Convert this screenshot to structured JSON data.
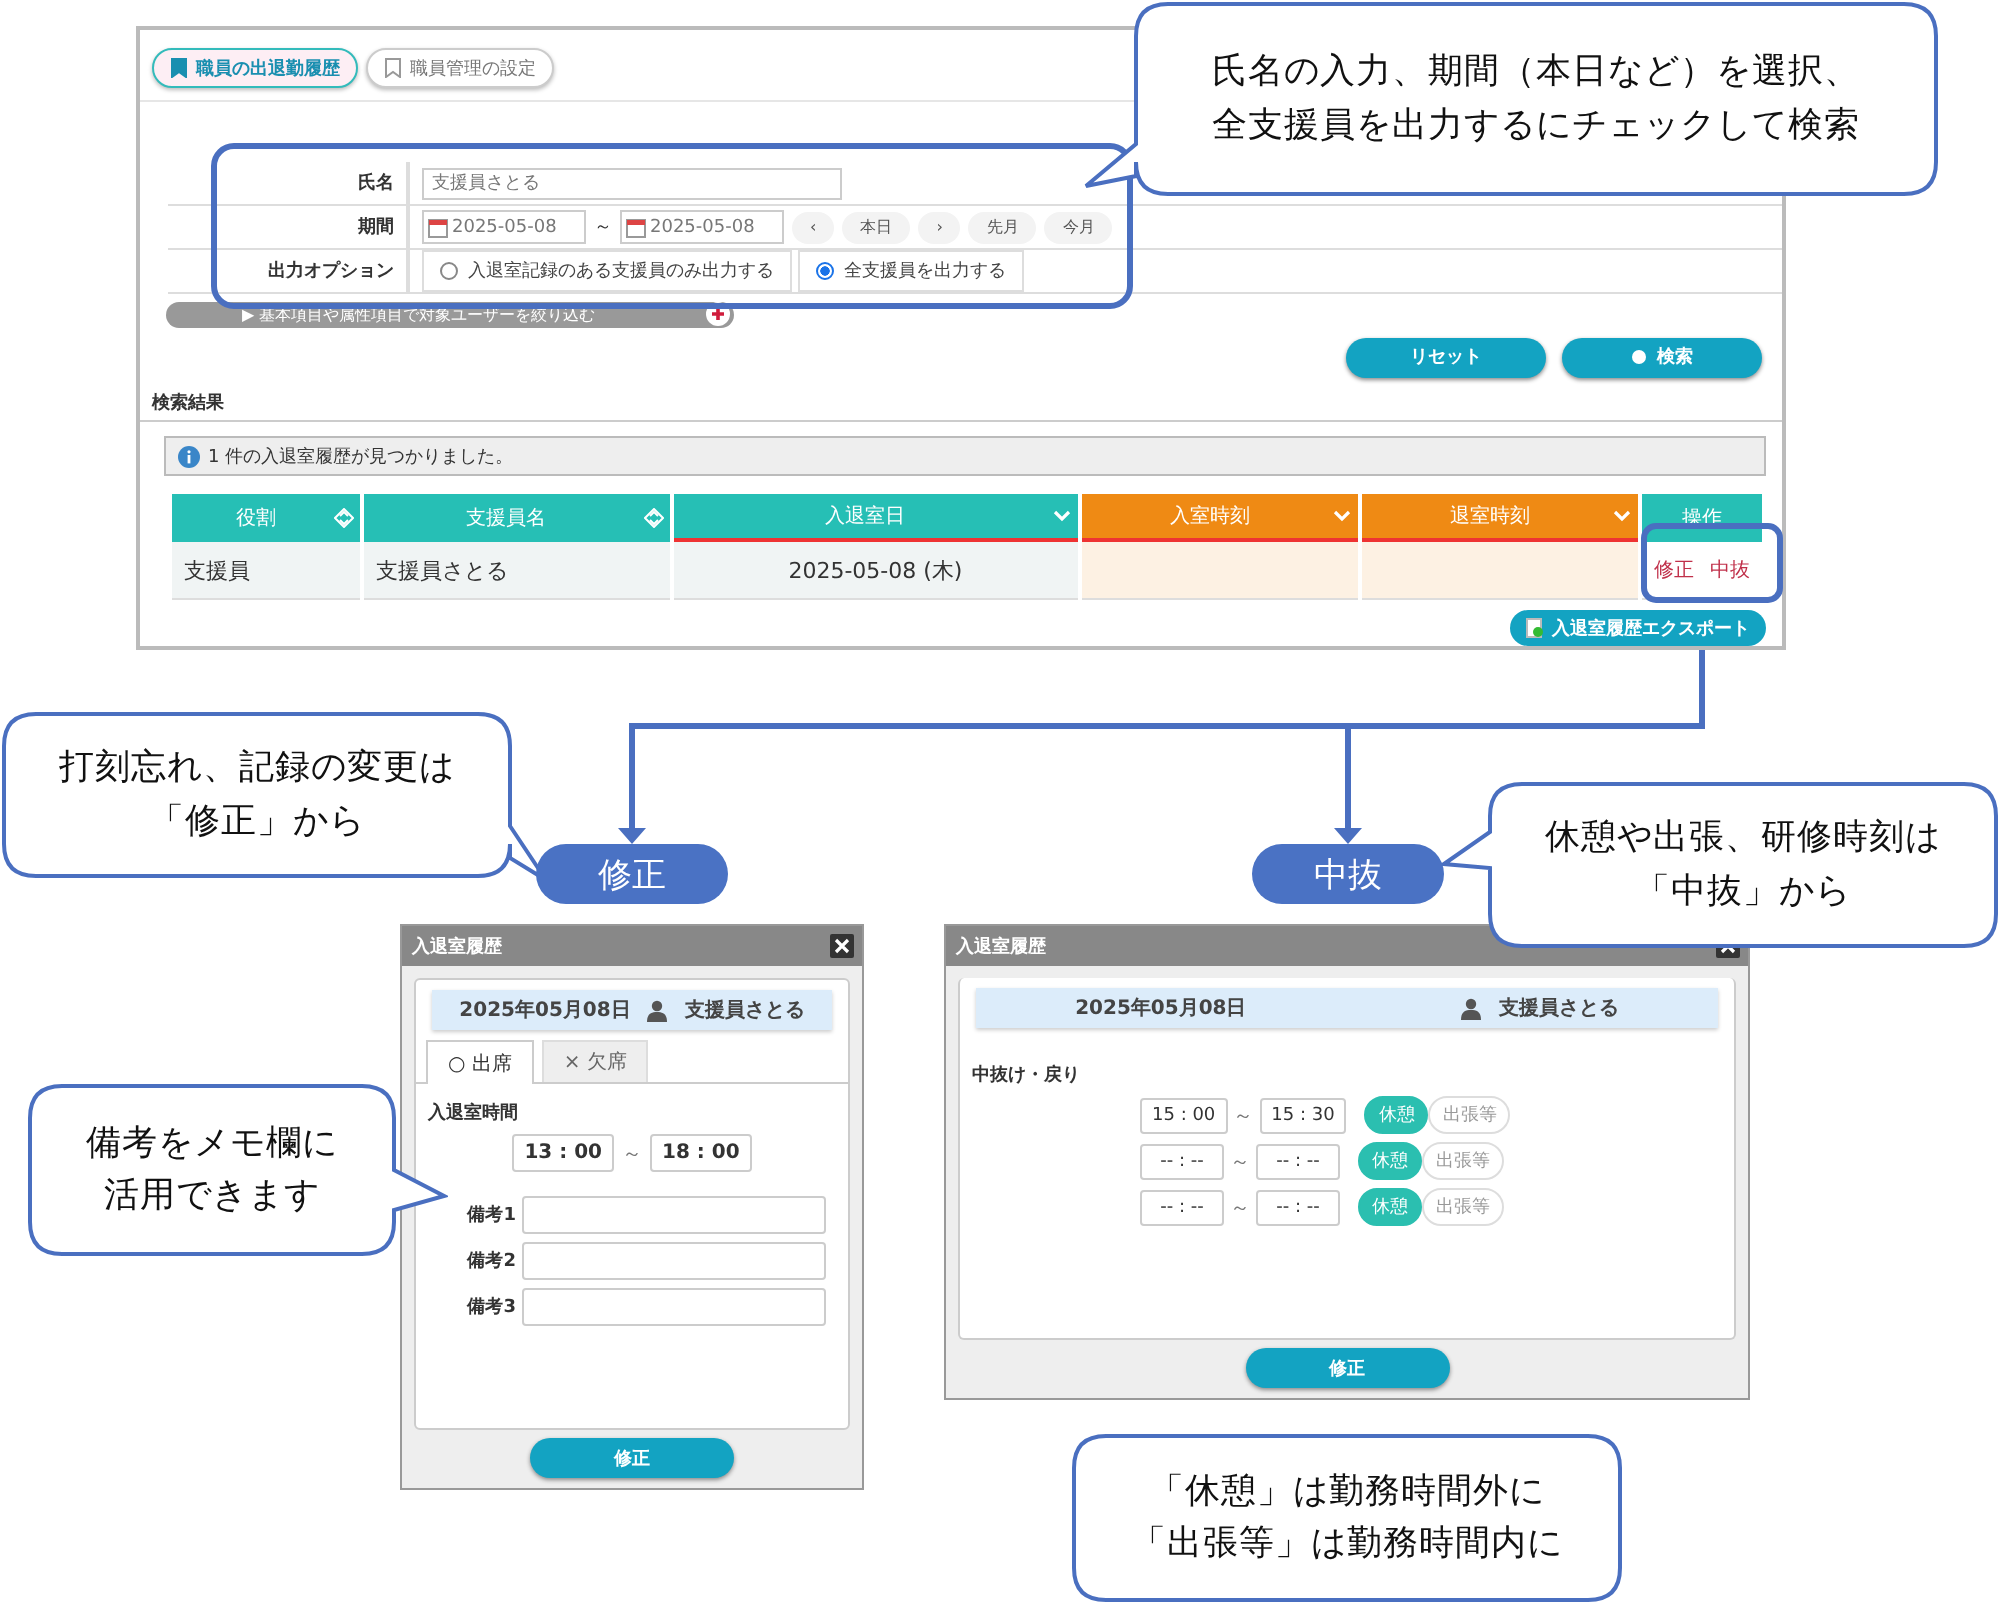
{
  "main_window": {
    "tabs": [
      {
        "label": "職員の出退勤履歴",
        "selected": true
      },
      {
        "label": "職員管理の設定",
        "selected": false
      }
    ],
    "search_form": {
      "rows": [
        {
          "label": "氏名",
          "kind": "text",
          "value": "支援員さとる"
        },
        {
          "label": "期間",
          "kind": "period",
          "from": "2025-05-08",
          "separator": "～",
          "to": "2025-05-08",
          "nav": [
            "‹",
            "本日",
            "›",
            "先月",
            "今月"
          ]
        },
        {
          "label": "出力オプション",
          "kind": "radio",
          "options": [
            {
              "label": "入退室記録のある支援員のみ出力する",
              "selected": false
            },
            {
              "label": "全支援員を出力する",
              "selected": true
            }
          ]
        }
      ]
    },
    "filter_bar": "▶ 基本項目や属性項目で対象ユーザーを絞り込む",
    "buttons": [
      {
        "label": "リセット",
        "kind": "plain"
      },
      {
        "label": "検索",
        "kind": "search"
      }
    ],
    "results_title": "検索結果",
    "message": "1 件の入退室履歴が見つかりました。",
    "table": {
      "columns": [
        {
          "label": "役割",
          "color": "#26bfb5",
          "kind": "both",
          "sorted": false
        },
        {
          "label": "支援員名",
          "color": "#26bfb5",
          "kind": "both",
          "sorted": false
        },
        {
          "label": "入退室日",
          "color": "#26bfb5",
          "kind": "down",
          "sorted": true
        },
        {
          "label": "入室時刻",
          "color": "#ef8a14",
          "kind": "down",
          "sorted": true
        },
        {
          "label": "退室時刻",
          "color": "#ef8a14",
          "kind": "down",
          "sorted": true
        },
        {
          "label": "操作",
          "color": "#26bfb5",
          "kind": "none",
          "sorted": false
        }
      ],
      "rows": [
        {
          "cells": [
            "支援員",
            "支援員さとる",
            "2025-05-08 (木)"
          ],
          "actions": [
            "修正",
            "中抜"
          ]
        }
      ]
    },
    "export_button": "入退室履歴エクスポート"
  },
  "callouts": [
    {
      "lines": [
        "氏名の入力、期間（本日など）を選択、",
        "全支援員を出力するにチェックして検索"
      ]
    },
    {
      "lines": [
        "打刻忘れ、記録の変更は",
        "「修正」から"
      ]
    },
    {
      "lines": [
        "休憩や出張、研修時刻は",
        "「中抜」から"
      ]
    },
    {
      "lines": [
        "備考をメモ欄に",
        "活用できます"
      ]
    },
    {
      "lines": [
        "「休憩」は勤務時間外に",
        "「出張等」は勤務時間内に"
      ]
    }
  ],
  "labels": [
    "修正",
    "中抜"
  ],
  "dialogs": [
    {
      "kind": "attendance",
      "title": "入退室履歴",
      "date": "2025年05月08日",
      "user": "支援員さとる",
      "tabs": [
        {
          "label": "○ 出席",
          "selected": true
        },
        {
          "label": "× 欠席",
          "selected": false
        }
      ],
      "time_label": "入退室時間",
      "from": "13 : 00",
      "separator": "～",
      "to": "18 : 00",
      "memos": [
        "備考1",
        "備考2",
        "備考3"
      ],
      "button": "修正"
    },
    {
      "kind": "break",
      "title": "入退室履歴",
      "date": "2025年05月08日",
      "user": "支援員さとる",
      "section": "中抜け・戻り",
      "rows": [
        {
          "from": "15 : 00",
          "separator": "～",
          "to": "15 : 30",
          "types": [
            {
              "label": "休憩",
              "selected": true
            },
            {
              "label": "出張等",
              "selected": false
            }
          ]
        },
        {
          "from": "-- : --",
          "separator": "～",
          "to": "-- : --",
          "types": [
            {
              "label": "休憩",
              "selected": true
            },
            {
              "label": "出張等",
              "selected": false
            }
          ]
        },
        {
          "from": "-- : --",
          "separator": "～",
          "to": "-- : --",
          "types": [
            {
              "label": "休憩",
              "selected": true
            },
            {
              "label": "出張等",
              "selected": false
            }
          ]
        }
      ],
      "button": "修正"
    }
  ]
}
